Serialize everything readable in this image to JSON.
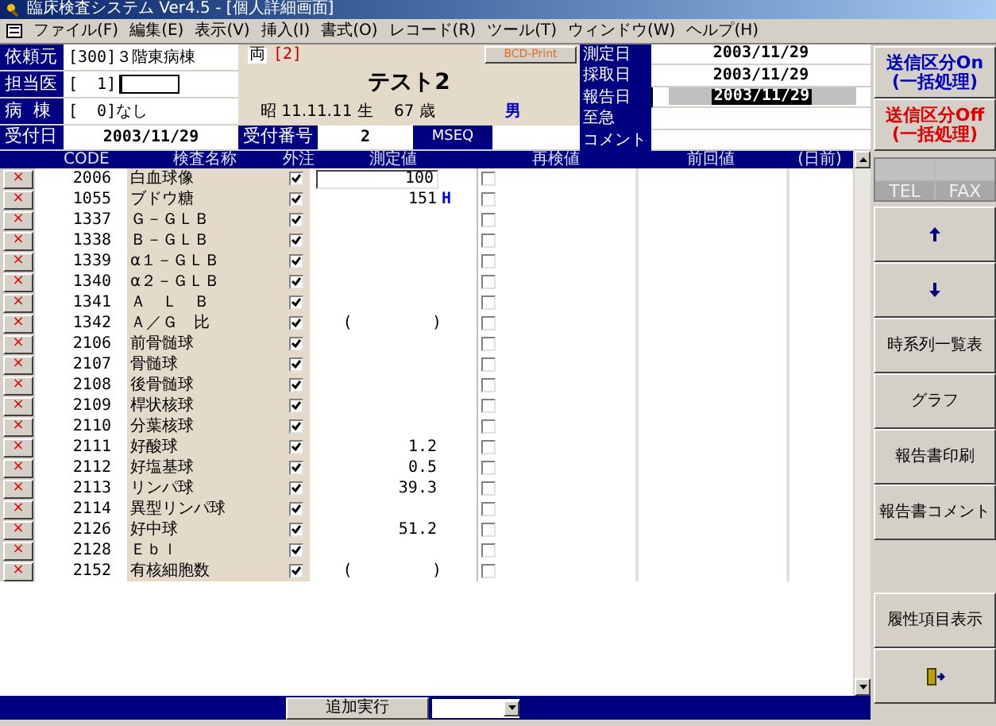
{
  "window": {
    "title": "臨床検査システム Ver4.5 - [個人詳細画面]"
  },
  "menu": [
    "ファイル(F)",
    "編集(E)",
    "表示(V)",
    "挿入(I)",
    "書式(O)",
    "レコード(R)",
    "ツール(T)",
    "ウィンドウ(W)",
    "ヘルプ(H)"
  ],
  "request": {
    "source_label": "依頼元",
    "source": "[300]３階東病棟",
    "doctor_label": "担当医",
    "doctor": "[  1]",
    "ward_label": "病  棟",
    "ward": "[  0]なし",
    "date_label": "受付日",
    "date": "2003/11/29",
    "number_label": "受付番号",
    "number": "2",
    "mseq_label": "MSEQ"
  },
  "patient": {
    "mark": "両",
    "id": "[2]",
    "name": "テスト2",
    "birth": "昭 11.11.11 生",
    "age": "67 歳",
    "sex": "男",
    "print_button": "BCD-Print"
  },
  "dates": [
    {
      "label": "測定日",
      "value": "2003/11/29",
      "selected": false
    },
    {
      "label": "採取日",
      "value": "2003/11/29",
      "selected": false
    },
    {
      "label": "報告日",
      "value": "2003/11/29",
      "selected": true
    },
    {
      "label": "至急",
      "selected": false
    },
    {
      "label": "コメント",
      "selected": false
    }
  ],
  "send_buttons": [
    {
      "label": "送信区分On\n(一括処理)",
      "color": "#0000c0"
    },
    {
      "label": "送信区分Off\n(一括処理)",
      "color": "#e00000"
    }
  ],
  "table": {
    "columns": [
      "CODE",
      "検査名称",
      "外注",
      "測定値",
      "再検値",
      "前回値",
      "(日前)"
    ],
    "rows": [
      {
        "delete": "×",
        "code": "2006",
        "name": "白血球像",
        "outsourced": true,
        "kind": "field",
        "value": "100",
        "recheck": false
      },
      {
        "delete": "×",
        "code": "1055",
        "name": "ブドウ糖",
        "outsourced": true,
        "kind": "plain",
        "value": "151",
        "flag": "H",
        "recheck": false
      },
      {
        "delete": "×",
        "code": "1337",
        "name": "Ｇ－ＧＬＢ",
        "outsourced": true,
        "kind": "plain",
        "value": "",
        "recheck": false
      },
      {
        "delete": "×",
        "code": "1338",
        "name": "Ｂ－ＧＬＢ",
        "outsourced": true,
        "kind": "plain",
        "value": "",
        "recheck": false
      },
      {
        "delete": "×",
        "code": "1339",
        "name": "α１－ＧＬＢ",
        "outsourced": true,
        "kind": "plain",
        "value": "",
        "recheck": false
      },
      {
        "delete": "×",
        "code": "1340",
        "name": "α２－ＧＬＢ",
        "outsourced": true,
        "kind": "plain",
        "value": "",
        "recheck": false
      },
      {
        "delete": "×",
        "code": "1341",
        "name": "Ａ　Ｌ　Ｂ",
        "outsourced": true,
        "kind": "plain",
        "value": "",
        "recheck": false
      },
      {
        "delete": "×",
        "code": "1342",
        "name": "Ａ／Ｇ　比",
        "outsourced": true,
        "kind": "bracket",
        "brackets": [
          "(",
          ")"
        ],
        "recheck": false
      },
      {
        "delete": "×",
        "code": "2106",
        "name": "前骨髄球",
        "outsourced": true,
        "kind": "plain",
        "value": "",
        "recheck": false
      },
      {
        "delete": "×",
        "code": "2107",
        "name": "骨髄球",
        "outsourced": true,
        "kind": "plain",
        "value": "",
        "recheck": false
      },
      {
        "delete": "×",
        "code": "2108",
        "name": "後骨髄球",
        "outsourced": true,
        "kind": "plain",
        "value": "",
        "recheck": false
      },
      {
        "delete": "×",
        "code": "2109",
        "name": "桿状核球",
        "outsourced": true,
        "kind": "plain",
        "value": "",
        "recheck": false
      },
      {
        "delete": "×",
        "code": "2110",
        "name": "分葉核球",
        "outsourced": true,
        "kind": "plain",
        "value": "",
        "recheck": false
      },
      {
        "delete": "×",
        "code": "2111",
        "name": "好酸球",
        "outsourced": true,
        "kind": "plain",
        "value": "1.2",
        "recheck": false
      },
      {
        "delete": "×",
        "code": "2112",
        "name": "好塩基球",
        "outsourced": true,
        "kind": "plain",
        "value": "0.5",
        "recheck": false
      },
      {
        "delete": "×",
        "code": "2113",
        "name": "リンパ球",
        "outsourced": true,
        "kind": "plain",
        "value": "39.3",
        "recheck": false
      },
      {
        "delete": "×",
        "code": "2114",
        "name": "異型リンパ球",
        "outsourced": true,
        "kind": "plain",
        "value": "",
        "recheck": false
      },
      {
        "delete": "×",
        "code": "2126",
        "name": "好中球",
        "outsourced": true,
        "kind": "plain",
        "value": "51.2",
        "recheck": false
      },
      {
        "delete": "×",
        "code": "2128",
        "name": "Ｅｂｌ",
        "outsourced": true,
        "kind": "plain",
        "value": "",
        "recheck": false
      },
      {
        "delete": "×",
        "code": "2152",
        "name": "有核細胞数",
        "outsourced": true,
        "kind": "bracket",
        "brackets": [
          "(",
          ")"
        ],
        "recheck": false
      }
    ]
  },
  "add_button": "追加実行",
  "contact": [
    "TEL",
    "FAX"
  ],
  "side_buttons": [
    {
      "kind": "up"
    },
    {
      "kind": "down"
    },
    {
      "kind": "text",
      "label": "時系列一覧表"
    },
    {
      "kind": "text",
      "label": "グラフ"
    },
    {
      "kind": "text",
      "label": "報告書印刷"
    },
    {
      "kind": "text",
      "label": "報告書コメント"
    },
    {
      "kind": "gap"
    },
    {
      "kind": "text",
      "label": "履性項目表示"
    },
    {
      "kind": "exit"
    }
  ]
}
